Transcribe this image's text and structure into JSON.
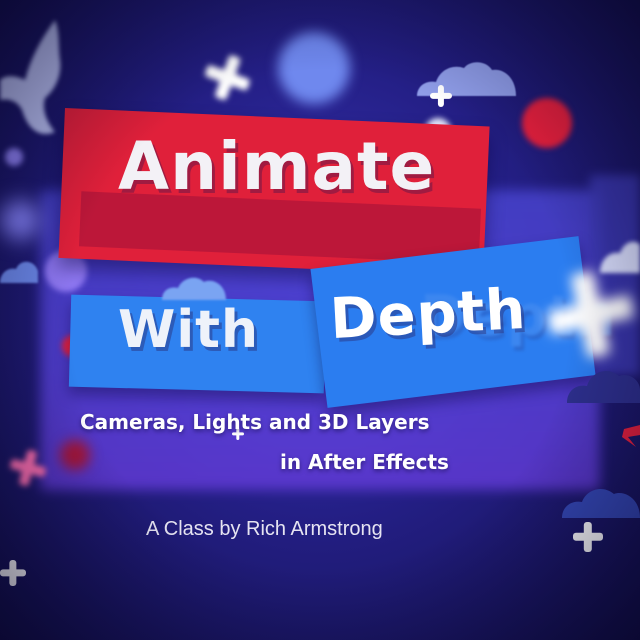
{
  "title": {
    "line1": "Animate",
    "line2_left": "With",
    "line2_right": "Depth"
  },
  "subtitle": {
    "line1": "Cameras, Lights and 3D Layers",
    "line2": "in After Effects"
  },
  "byline": "A Class by Rich Armstrong",
  "colors": {
    "background": "#241f86",
    "red_band": "#e0203a",
    "blue_band": "#2f82f0",
    "text": "#ffffff",
    "accent_red_dot": "#e8203c",
    "pink_plus": "#ff6fb0"
  },
  "icons": [
    "bird-icon",
    "cloud-icon",
    "plus-icon",
    "dot-icon"
  ]
}
